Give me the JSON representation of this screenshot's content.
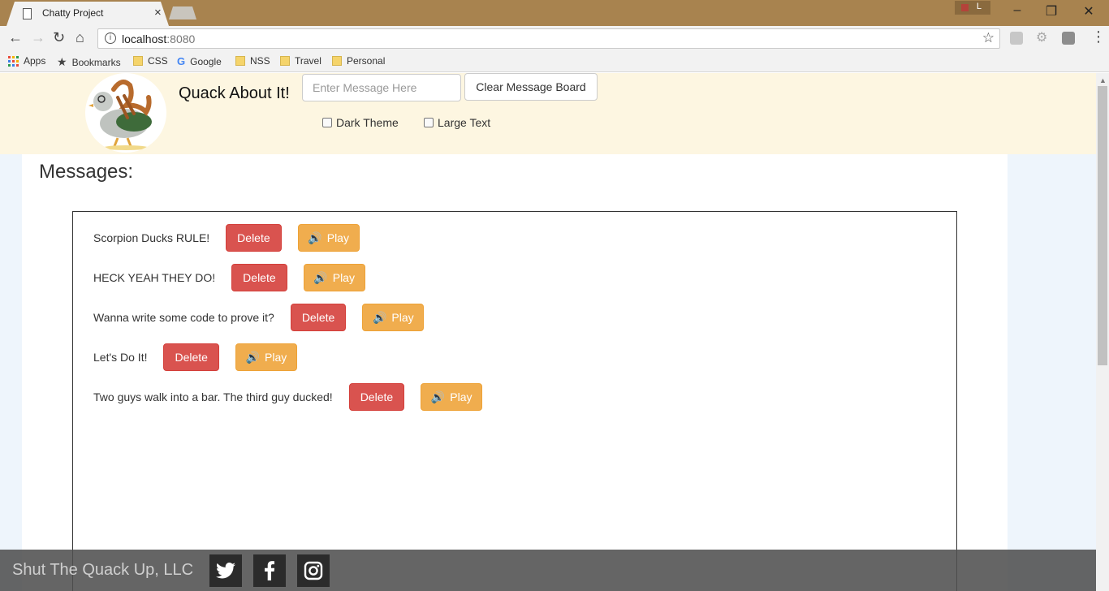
{
  "browser": {
    "tab_title": "Chatty Project",
    "tab_close": "×",
    "profile_initial": "L",
    "url_host": "localhost",
    "url_port": ":8080",
    "bookmarks": [
      {
        "label": "Apps",
        "icon": "apps-grid-icon"
      },
      {
        "label": "Bookmarks",
        "icon": "star-icon"
      },
      {
        "label": "CSS",
        "icon": "folder-icon"
      },
      {
        "label": "Google",
        "icon": "google-icon"
      },
      {
        "label": "NSS",
        "icon": "folder-icon"
      },
      {
        "label": "Travel",
        "icon": "folder-icon"
      },
      {
        "label": "Personal",
        "icon": "folder-icon"
      }
    ]
  },
  "header": {
    "title": "Quack About It!",
    "input_placeholder": "Enter Message Here",
    "clear_label": "Clear Message Board",
    "dark_theme_label": "Dark Theme",
    "large_text_label": "Large Text"
  },
  "main": {
    "heading": "Messages:",
    "delete_label": "Delete",
    "play_label": "Play",
    "messages": [
      "Scorpion Ducks RULE!",
      "HECK YEAH THEY DO!",
      "Wanna write some code to prove it?",
      "Let's Do It!",
      "Two guys walk into a bar. The third guy ducked!"
    ]
  },
  "footer": {
    "text": "Shut The Quack Up, LLC",
    "social": [
      "twitter-icon",
      "facebook-icon",
      "instagram-icon"
    ]
  },
  "colors": {
    "header_bg": "#fdf6e1",
    "delete": "#d9534f",
    "play": "#f0ad4e",
    "tabstrip": "#a8834f"
  }
}
